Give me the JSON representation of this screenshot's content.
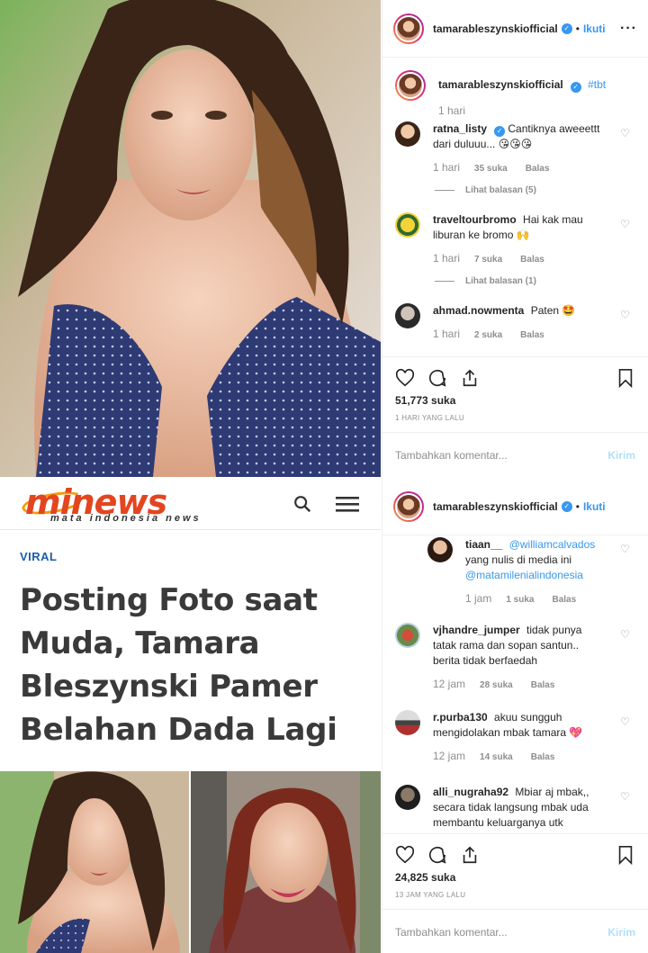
{
  "post1": {
    "username": "tamarableszynskiofficial",
    "follow_label": "Ikuti",
    "caption_user": "tamarableszynskiofficial",
    "caption_tag": "#tbt",
    "caption_time": "1 hari",
    "comments": [
      {
        "user": "ratna_listy",
        "verified": true,
        "text": "Cantiknya aweeettt dari duluuu... 😘😘😘",
        "time": "1 hari",
        "likes": "35 suka",
        "reply": "Balas",
        "view_replies": "Lihat balasan (5)"
      },
      {
        "user": "traveltourbromo",
        "text": "Hai kak mau liburan ke bromo 🙌",
        "time": "1 hari",
        "likes": "7 suka",
        "reply": "Balas",
        "view_replies": "Lihat balasan (1)"
      },
      {
        "user": "ahmad.nowmenta",
        "text": "Paten 🤩",
        "time": "1 hari",
        "likes": "2 suka",
        "reply": "Balas"
      }
    ],
    "likes": "51,773 suka",
    "posted": "1 HARI YANG LALU",
    "add_comment_placeholder": "Tambahkan komentar...",
    "send_label": "Kirim"
  },
  "news": {
    "logo_text": "minews",
    "logo_tagline": "mata indonesia news",
    "category": "VIRAL",
    "headline": "Posting Foto saat Muda, Tamara Bleszynski Pamer Belahan Dada Lagi"
  },
  "post2": {
    "username": "tamarableszynskiofficial",
    "follow_label": "Ikuti",
    "comments": [
      {
        "user": "tiaan__",
        "mention": "@williamcalvados",
        "text": "yang nulis di media ini",
        "mention2": "@matamilenialindonesia",
        "time": "1 jam",
        "likes": "1 suka",
        "reply": "Balas"
      },
      {
        "user": "vjhandre_jumper",
        "text": "tidak punya tatak rama dan sopan santun.. berita tidak berfaedah",
        "time": "12 jam",
        "likes": "28 suka",
        "reply": "Balas"
      },
      {
        "user": "r.purba130",
        "text": "akuu sungguh mengidolakan mbak tamara 💖",
        "time": "12 jam",
        "likes": "14 suka",
        "reply": "Balas"
      },
      {
        "user": "alli_nugraha92",
        "text": "Mbiar aj mbak,, secara tidak langsung mbak uda membantu keluarganya utk"
      }
    ],
    "likes": "24,825 suka",
    "posted": "13 JAM YANG LALU",
    "add_comment_placeholder": "Tambahkan komentar...",
    "send_label": "Kirim"
  },
  "colors": {
    "link": "#3897f0",
    "logo": "#e3451f",
    "viral": "#1b5fa8"
  }
}
